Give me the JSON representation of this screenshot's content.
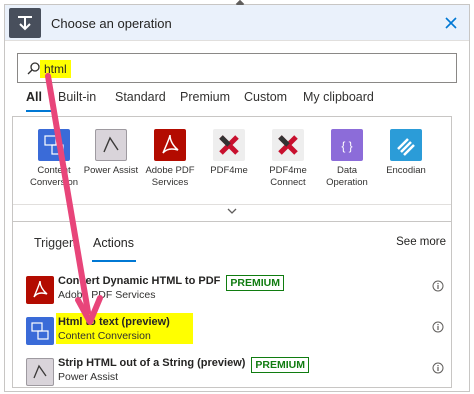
{
  "header": {
    "title": "Choose an operation"
  },
  "search": {
    "value": "html"
  },
  "filter_tabs": [
    "All",
    "Built-in",
    "Standard",
    "Premium",
    "Custom",
    "My clipboard"
  ],
  "connectors": [
    {
      "label_1": "Content",
      "label_2": "Conversion",
      "icon": "content-conversion-icon",
      "color": "#3a6bd8"
    },
    {
      "label_1": "Power Assist",
      "label_2": "",
      "icon": "power-assist-icon",
      "color": "#d9d4da"
    },
    {
      "label_1": "Adobe PDF",
      "label_2": "Services",
      "icon": "adobe-pdf-icon",
      "color": "#b30b00"
    },
    {
      "label_1": "PDF4me",
      "label_2": "",
      "icon": "pdf4me-icon",
      "color": "#eeeeee"
    },
    {
      "label_1": "PDF4me",
      "label_2": "Connect",
      "icon": "pdf4me-connect-icon",
      "color": "#eeeeee"
    },
    {
      "label_1": "Data",
      "label_2": "Operation",
      "icon": "data-operation-icon",
      "color": "#8c6cd9"
    },
    {
      "label_1": "Encodian",
      "label_2": "",
      "icon": "encodian-icon",
      "color": "#2b9cd8"
    }
  ],
  "action_tabs": {
    "triggers": "Triggers",
    "actions": "Actions",
    "see_more": "See more"
  },
  "actions": [
    {
      "title": "Convert Dynamic HTML to PDF",
      "subtitle": "Adobe PDF Services",
      "badge": "PREMIUM"
    },
    {
      "title": "Html to text (preview)",
      "subtitle": "Content Conversion",
      "badge": ""
    },
    {
      "title": "Strip HTML out of a String (preview)",
      "subtitle": "Power Assist",
      "badge": "PREMIUM"
    }
  ],
  "colors": {
    "accent": "#0078d4",
    "premium": "#107c10",
    "highlight": "#ffff00",
    "annotation_arrow": "#e8457a"
  }
}
